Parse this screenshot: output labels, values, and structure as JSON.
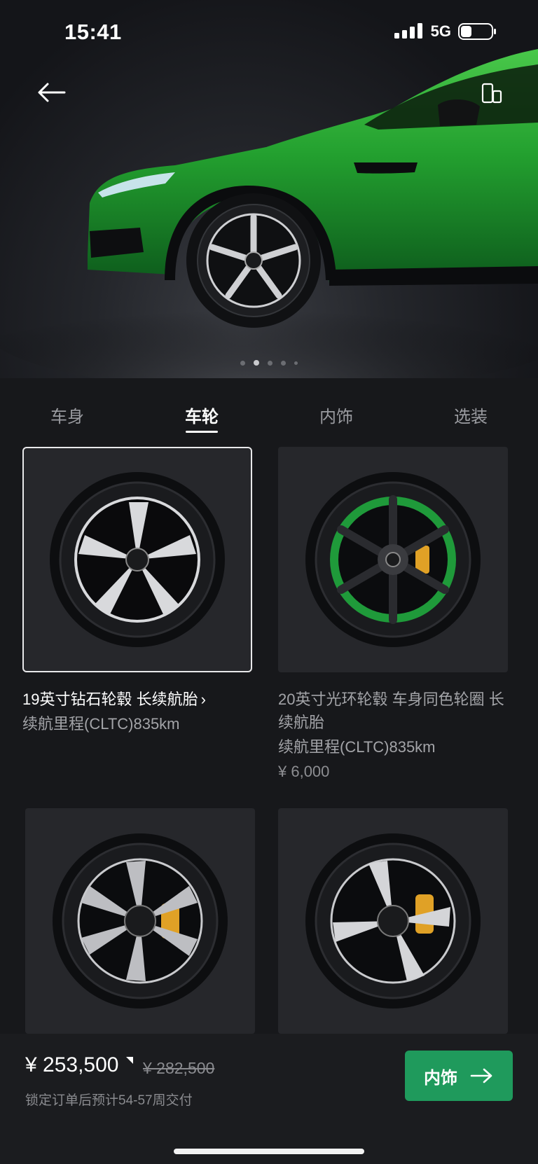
{
  "status_bar": {
    "time": "15:41",
    "network": "5G",
    "battery_percent": 35
  },
  "hero": {
    "carousel_pages": 5,
    "carousel_active_index": 1
  },
  "tabs": [
    {
      "label": "车身"
    },
    {
      "label": "车轮",
      "active": true
    },
    {
      "label": "内饰"
    },
    {
      "label": "选装"
    }
  ],
  "wheels": [
    {
      "title": "19英寸钻石轮毂 长续航胎",
      "range": "续航里程(CLTC)835km",
      "price": "",
      "selected": true
    },
    {
      "title": "20英寸光环轮毂 车身同色轮圈 长续航胎",
      "range": "续航里程(CLTC)835km",
      "price": "¥ 6,000",
      "selected": false
    },
    {
      "title": "",
      "range": "",
      "price": "",
      "selected": false
    },
    {
      "title": "",
      "range": "",
      "price": "",
      "selected": false
    }
  ],
  "summary": {
    "price": "¥ 253,500",
    "original_price": "¥ 282,500",
    "delivery_note": "锁定订单后预计54-57周交付",
    "next_label": "内饰"
  },
  "colors": {
    "accent_green": "#1f9a5c",
    "car_green": "#2fa83a",
    "background": "#17181b"
  }
}
